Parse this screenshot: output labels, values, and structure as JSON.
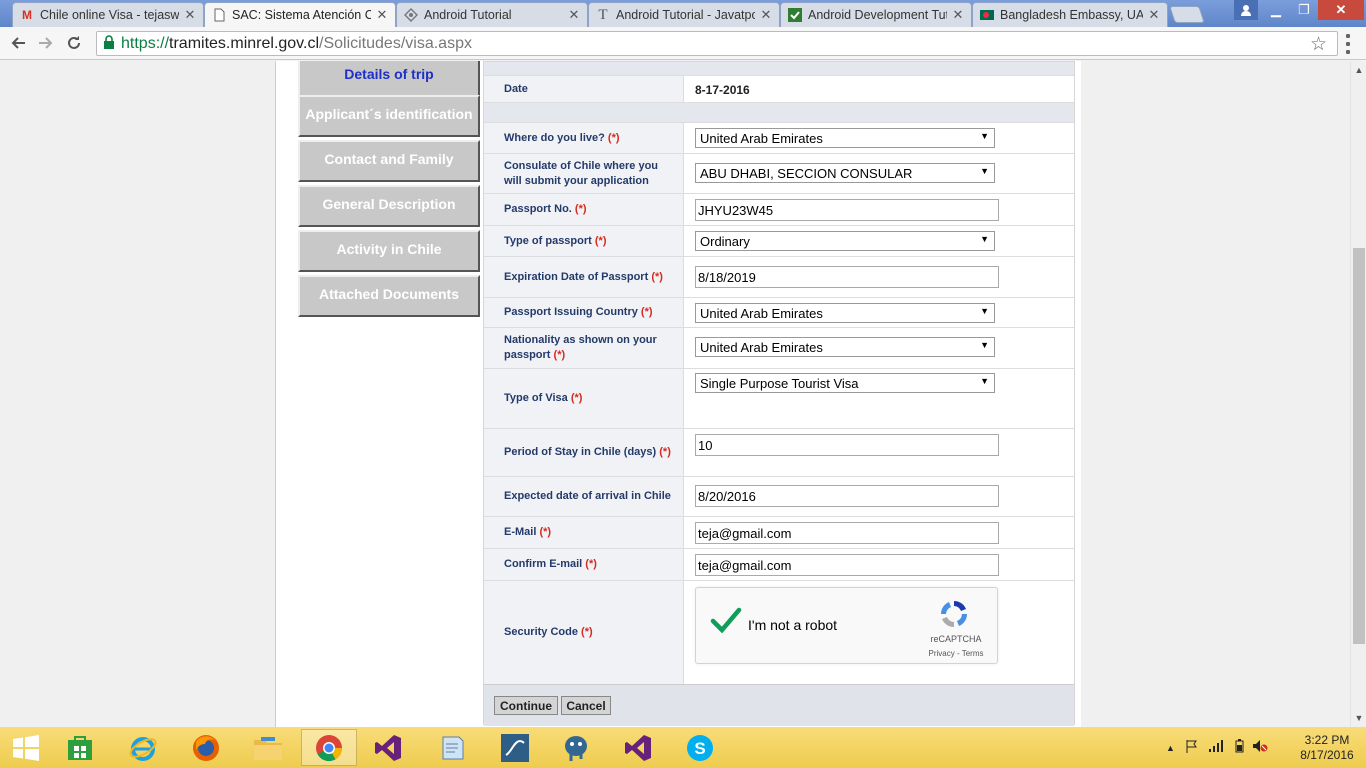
{
  "browser": {
    "tabs": [
      {
        "label": "Chile online Visa - tejaswi",
        "icon": "gmail-icon",
        "active": false
      },
      {
        "label": "SAC: Sistema Atención Co",
        "icon": "page-icon",
        "active": true
      },
      {
        "label": "Android Tutorial",
        "icon": "diamond-icon",
        "active": false
      },
      {
        "label": "Android Tutorial - Javatpo",
        "icon": "t-icon",
        "active": false
      },
      {
        "label": "Android Development Tut",
        "icon": "green-check-icon",
        "active": false
      },
      {
        "label": "Bangladesh Embassy, UAE",
        "icon": "flag-icon",
        "active": false
      }
    ],
    "url": {
      "scheme": "https://",
      "host": "tramites.minrel.gov.cl",
      "path": "/Solicitudes/visa.aspx"
    }
  },
  "sidebar": {
    "items": [
      {
        "label": "Details of trip",
        "current": true
      },
      {
        "label": "Applicant´s identification",
        "current": false
      },
      {
        "label": "Contact and Family",
        "current": false
      },
      {
        "label": "General Description",
        "current": false
      },
      {
        "label": "Activity in Chile",
        "current": false
      },
      {
        "label": "Attached Documents",
        "current": false
      }
    ]
  },
  "form": {
    "date_label": "Date",
    "date_value": "8-17-2016",
    "required_mark": "(*)",
    "fields": {
      "live": {
        "label": "Where do you live?",
        "value": "United Arab Emirates"
      },
      "consulate": {
        "label": "Consulate of Chile where you will submit your application",
        "value": "ABU DHABI, SECCION CONSULAR"
      },
      "passport_no": {
        "label": "Passport No.",
        "value": "JHYU23W45"
      },
      "passport_type": {
        "label": "Type of passport",
        "value": "Ordinary"
      },
      "expiration": {
        "label": "Expiration Date of Passport",
        "value": "8/18/2019"
      },
      "issuing_country": {
        "label": "Passport Issuing Country",
        "value": "United Arab Emirates"
      },
      "nationality": {
        "label": "Nationality as shown on your passport",
        "value": "United Arab Emirates"
      },
      "visa_type": {
        "label": "Type of Visa",
        "value": "Single Purpose Tourist Visa"
      },
      "stay": {
        "label": "Period of Stay in Chile (days)",
        "value": "10"
      },
      "arrival": {
        "label": "Expected date of arrival in Chile",
        "value": "8/20/2016"
      },
      "email": {
        "label": "E-Mail",
        "value": "teja@gmail.com"
      },
      "confirm_email": {
        "label": "Confirm E-mail",
        "value": "teja@gmail.com"
      },
      "security": {
        "label": "Security Code"
      }
    },
    "captcha": {
      "text": "I'm not a robot",
      "brand": "reCAPTCHA",
      "terms": "Privacy - Terms",
      "checked": true
    },
    "buttons": {
      "continue": "Continue",
      "cancel": "Cancel"
    }
  },
  "taskbar": {
    "apps": [
      "start",
      "store",
      "internet-explorer",
      "firefox",
      "file-explorer",
      "chrome",
      "visual-studio",
      "notepad",
      "mysql-workbench",
      "postgresql",
      "visual-studio-2",
      "skype"
    ],
    "active": "chrome",
    "clock_time": "3:22 PM",
    "clock_date": "8/17/2016"
  },
  "colors": {
    "accent_blue": "#1d2fc9",
    "label_blue": "#243a6a",
    "required_red": "#d52a1e",
    "taskbar_yellow": "#f0cf58"
  }
}
